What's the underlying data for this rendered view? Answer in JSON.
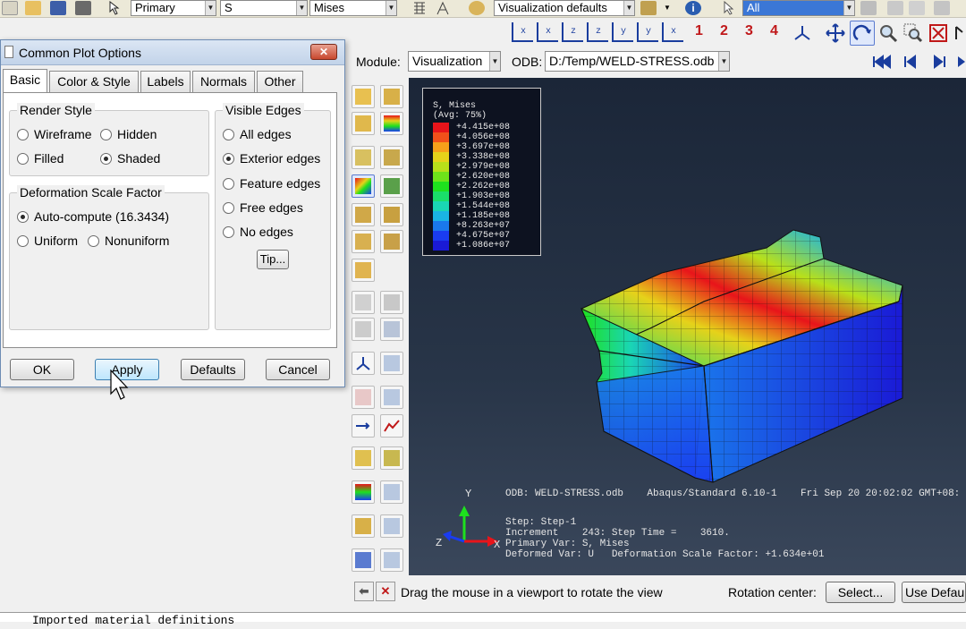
{
  "toolbar": {
    "primary_combo": "Primary",
    "variable_combo": "S",
    "invariant_combo": "Mises",
    "viz_defaults_combo": "Visualization defaults",
    "selection_combo": "All",
    "view_numbers": [
      "1",
      "2",
      "3",
      "4"
    ]
  },
  "module_row": {
    "module_label": "Module:",
    "module_value": "Visualization",
    "odb_label": "ODB:",
    "odb_value": "D:/Temp/WELD-STRESS.odb"
  },
  "dialog": {
    "title": "Common Plot Options",
    "tabs": [
      "Basic",
      "Color & Style",
      "Labels",
      "Normals",
      "Other"
    ],
    "render_style": {
      "title": "Render Style",
      "options": [
        "Wireframe",
        "Hidden",
        "Filled",
        "Shaded"
      ],
      "selected": "Shaded"
    },
    "deformation": {
      "title": "Deformation Scale Factor",
      "auto_compute": "Auto-compute (16.3434)",
      "uniform": "Uniform",
      "nonuniform": "Nonuniform",
      "selected": "Auto-compute (16.3434)"
    },
    "visible_edges": {
      "title": "Visible Edges",
      "options": [
        "All edges",
        "Exterior edges",
        "Feature edges",
        "Free edges",
        "No edges"
      ],
      "selected": "Exterior edges",
      "tip_button": "Tip..."
    },
    "buttons": {
      "ok": "OK",
      "apply": "Apply",
      "defaults": "Defaults",
      "cancel": "Cancel"
    }
  },
  "legend": {
    "title_line1": "S, Mises",
    "title_line2": "(Avg: 75%)",
    "values": [
      "+4.415e+08",
      "+4.056e+08",
      "+3.697e+08",
      "+3.338e+08",
      "+2.979e+08",
      "+2.620e+08",
      "+2.262e+08",
      "+1.903e+08",
      "+1.544e+08",
      "+1.185e+08",
      "+8.263e+07",
      "+4.675e+07",
      "+1.086e+07"
    ],
    "colors": [
      "#e8141a",
      "#f2501a",
      "#f6a01a",
      "#e6d21a",
      "#b8e01a",
      "#6ee41a",
      "#1ee01e",
      "#1ade6a",
      "#1ad6b4",
      "#1ab4e4",
      "#1a78ec",
      "#1a3cf0",
      "#1a1ad6"
    ]
  },
  "viewport": {
    "axis_y": "Y",
    "axis_x": "X",
    "axis_z": "Z",
    "odb_line": "ODB: WELD-STRESS.odb    Abaqus/Standard 6.10-1    Fri Sep 20 20:02:02 GMT+08:",
    "step_line": "Step: Step-1",
    "increment_line": "Increment    243: Step Time =    3610.",
    "primary_var_line": "Primary Var: S, Mises",
    "deformed_var_line": "Deformed Var: U   Deformation Scale Factor: +1.634e+01"
  },
  "prompt": {
    "message": "Drag the mouse in a viewport to rotate the view",
    "rotation_center_label": "Rotation center:",
    "select_button": "Select...",
    "use_default_button": "Use Defaul"
  },
  "message_area": {
    "text": "Imported material definitions"
  }
}
